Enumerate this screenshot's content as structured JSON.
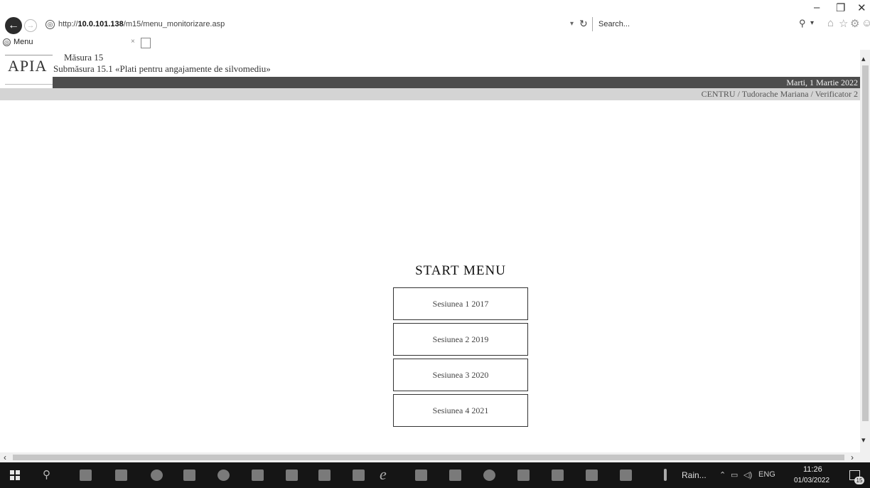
{
  "browser": {
    "url_prefix": "http://",
    "url_host": "10.0.101.138",
    "url_path": "/m15/menu_monitorizare.asp",
    "search_placeholder": "Search...",
    "tab_title": "Menu",
    "tab_close": "×"
  },
  "header": {
    "logo_text": "APIA",
    "measure": "Măsura 15",
    "submeasure": "Submăsura 15.1 «Plati pentru angajamente de silvomediu»",
    "date": "Marti, 1 Martie 2022",
    "user_info": "CENTRU / Tudorache Mariana / Verificator 2"
  },
  "menu": {
    "heading": "START MENU",
    "items": [
      {
        "label": "Sesiunea 1 2017"
      },
      {
        "label": "Sesiunea 2 2019"
      },
      {
        "label": "Sesiunea 3 2020"
      },
      {
        "label": "Sesiunea 4 2021"
      }
    ]
  },
  "taskbar": {
    "weather": "Rain...",
    "language": "ENG",
    "time": "11:26",
    "date": "01/03/2022",
    "notification_count": "15"
  },
  "icons": [
    "back-arrow-icon",
    "forward-arrow-icon",
    "globe-icon",
    "refresh-icon",
    "search-icon",
    "home-icon",
    "star-icon",
    "gear-icon",
    "smiley-icon",
    "windows-start-icon",
    "internet-explorer-icon"
  ]
}
